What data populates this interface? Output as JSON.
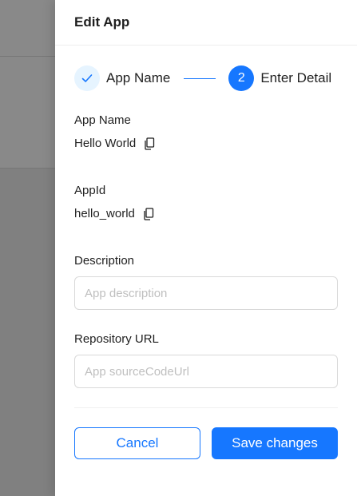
{
  "drawer": {
    "title": "Edit App"
  },
  "steps": [
    {
      "label": "App Name",
      "status": "done",
      "icon": "check-icon"
    },
    {
      "label": "Enter Detail",
      "status": "active",
      "number": "2"
    }
  ],
  "fields": {
    "app_name": {
      "label": "App Name",
      "value": "Hello World",
      "icon": "copy-icon"
    },
    "app_id": {
      "label": "AppId",
      "value": "hello_world",
      "icon": "copy-icon"
    },
    "description": {
      "label": "Description",
      "value": "",
      "placeholder": "App description"
    },
    "repository": {
      "label": "Repository URL",
      "value": "",
      "placeholder": "App sourceCodeUrl"
    }
  },
  "actions": {
    "cancel_label": "Cancel",
    "save_label": "Save changes"
  },
  "colors": {
    "primary": "#1677ff",
    "step_done_bg": "#e6f4ff",
    "backdrop": "#808080"
  }
}
